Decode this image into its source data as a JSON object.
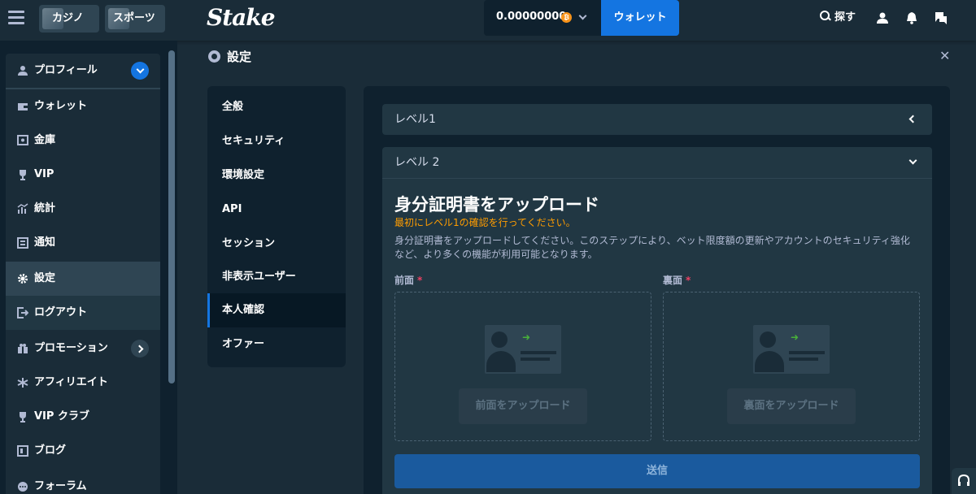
{
  "topbar": {
    "casino_tab": "カジノ",
    "sports_tab": "スポーツ",
    "logo": "Stake",
    "balance": "0.00000000",
    "currency_icon": "bitcoin-icon",
    "wallet_button": "ウォレット",
    "search_label": "探す"
  },
  "sidebar": {
    "profile": "プロフィール",
    "items": [
      {
        "label": "ウォレット",
        "icon": "wallet-icon"
      },
      {
        "label": "金庫",
        "icon": "vault-icon"
      },
      {
        "label": "VIP",
        "icon": "trophy-icon"
      },
      {
        "label": "統計",
        "icon": "stats-icon"
      },
      {
        "label": "通知",
        "icon": "notification-icon"
      },
      {
        "label": "設定",
        "icon": "gear-icon"
      },
      {
        "label": "ログアウト",
        "icon": "logout-icon"
      },
      {
        "label": "プロモーション",
        "icon": "gift-icon"
      },
      {
        "label": "アフィリエイト",
        "icon": "affiliate-icon"
      },
      {
        "label": "VIP クラブ",
        "icon": "trophy-icon"
      },
      {
        "label": "ブログ",
        "icon": "blog-icon"
      },
      {
        "label": "フォーラム",
        "icon": "forum-icon"
      }
    ]
  },
  "page": {
    "title": "設定"
  },
  "settings_nav": [
    "全般",
    "セキュリティ",
    "環境設定",
    "API",
    "セッション",
    "非表示ユーザー",
    "本人確認",
    "オファー"
  ],
  "verification": {
    "level1": "レベル1",
    "level2": "レベル 2",
    "title": "身分証明書をアップロード",
    "warning": "最初にレベル1の確認を行ってください。",
    "description": "身分証明書をアップロードしてください。このステップにより、ベット限度額の更新やアカウントのセキュリティ強化など、より多くの機能が利用可能となります。",
    "front_label": "前面",
    "back_label": "裏面",
    "required_mark": "*",
    "front_button": "前面をアップロード",
    "back_button": "裏面をアップロード",
    "submit": "送信"
  },
  "colors": {
    "accent": "#1475e1",
    "warning": "#ff9d00",
    "required": "#ed4163",
    "background": "#1a2c38"
  }
}
